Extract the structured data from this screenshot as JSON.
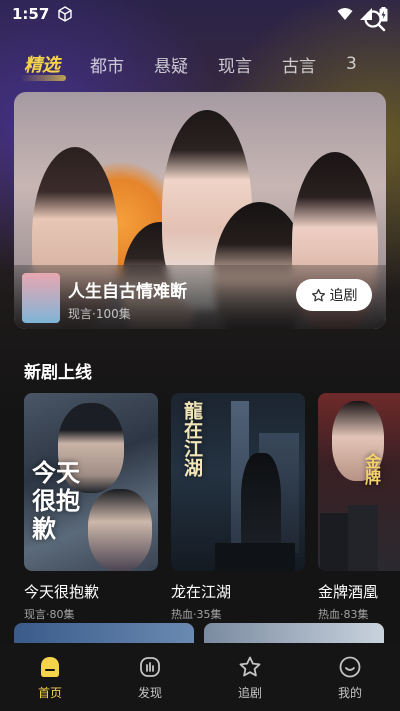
{
  "status_bar": {
    "time": "1:57"
  },
  "tabs": [
    {
      "label": "精选",
      "active": true
    },
    {
      "label": "都市"
    },
    {
      "label": "悬疑"
    },
    {
      "label": "现言"
    },
    {
      "label": "古言"
    },
    {
      "label": "3"
    }
  ],
  "banner": {
    "title": "人生自古情难断",
    "meta": "现言·100集",
    "follow_label": "追剧"
  },
  "section": {
    "title": "新剧上线"
  },
  "dramas": [
    {
      "title": "今天很抱歉",
      "meta": "现言·80集",
      "poster_text": "今天很抱歉"
    },
    {
      "title": "龙在江湖",
      "meta": "热血·35集",
      "poster_text": "龍在江湖"
    },
    {
      "title": "金牌酒凰",
      "meta": "热血·83集",
      "poster_text": "金牌"
    }
  ],
  "bottom_nav": [
    {
      "label": "首页",
      "icon": "home-icon",
      "active": true
    },
    {
      "label": "发现",
      "icon": "discover-icon"
    },
    {
      "label": "追剧",
      "icon": "star-icon"
    },
    {
      "label": "我的",
      "icon": "profile-icon"
    }
  ],
  "colors": {
    "accent": "#f5d34a",
    "background": "#141414"
  }
}
